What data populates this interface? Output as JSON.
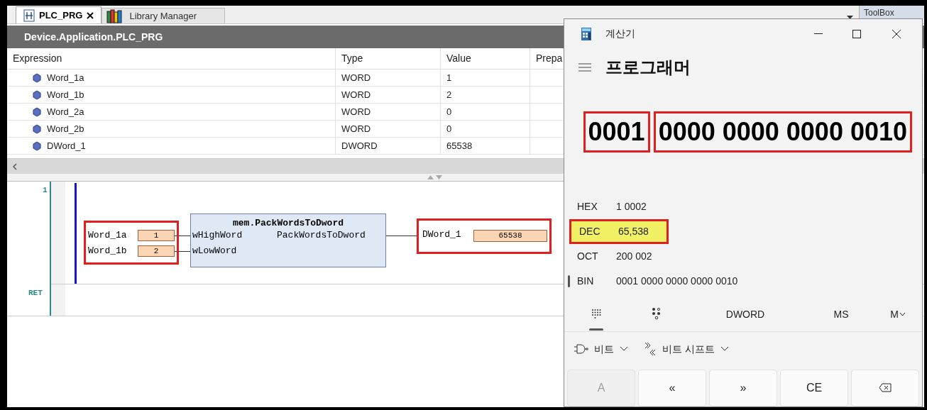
{
  "ide": {
    "tabs": [
      {
        "label": "PLC_PRG",
        "selected": true,
        "closable": true
      },
      {
        "label": "Library Manager",
        "selected": false,
        "closable": false
      }
    ],
    "toolbox": "ToolBox",
    "path": "Device.Application.PLC_PRG",
    "watch": {
      "columns": [
        "Expression",
        "Type",
        "Value",
        "Prepa"
      ],
      "rows": [
        {
          "expression": "Word_1a",
          "type": "WORD",
          "value": "1"
        },
        {
          "expression": "Word_1b",
          "type": "WORD",
          "value": "2"
        },
        {
          "expression": "Word_2a",
          "type": "WORD",
          "value": "0"
        },
        {
          "expression": "Word_2b",
          "type": "WORD",
          "value": "0"
        },
        {
          "expression": "DWord_1",
          "type": "DWORD",
          "value": "65538"
        }
      ]
    },
    "ladder": {
      "network_number": "1",
      "return_label": "RET",
      "block": {
        "title": "mem.PackWordsToDword",
        "inputs": [
          {
            "pin": "wHighWord",
            "variable": "Word_1a",
            "value": "1"
          },
          {
            "pin": "wLowWord",
            "variable": "Word_1b",
            "value": "2"
          }
        ],
        "output": {
          "pin": "PackWordsToDword",
          "variable": "DWord_1",
          "value": "65538"
        },
        "inputs_highlighted": true,
        "output_highlighted": true
      }
    }
  },
  "calculator": {
    "title": "계산기",
    "mode": "프로그래머",
    "display": [
      {
        "text": "0001",
        "highlighted": true
      },
      {
        "text": "0000 0000 0000 0010",
        "highlighted": true
      }
    ],
    "radix": [
      {
        "label": "HEX",
        "value": "1 0002",
        "selected": false,
        "highlighted": false
      },
      {
        "label": "DEC",
        "value": "65,538",
        "selected": false,
        "highlighted": true
      },
      {
        "label": "OCT",
        "value": "200 002",
        "selected": false,
        "highlighted": false
      },
      {
        "label": "BIN",
        "value": "0001 0000 0000 0000 0010",
        "selected": true,
        "highlighted": false
      }
    ],
    "toolbar": [
      {
        "kind": "keypad",
        "selected": true
      },
      {
        "kind": "bitpad",
        "selected": false
      },
      {
        "kind": "text",
        "label": "DWORD"
      },
      {
        "kind": "text",
        "label": "MS"
      },
      {
        "kind": "menu",
        "label": "M"
      }
    ],
    "bit_menus": [
      {
        "kind": "bitwise",
        "label": "비트"
      },
      {
        "kind": "shift",
        "label": "비트 시프트"
      }
    ],
    "keys": [
      {
        "kind": "text",
        "label": "A",
        "disabled": true
      },
      {
        "kind": "text",
        "label": "«",
        "disabled": false
      },
      {
        "kind": "text",
        "label": "»",
        "disabled": false
      },
      {
        "kind": "text",
        "label": "CE",
        "disabled": false
      },
      {
        "kind": "backspace",
        "disabled": false
      }
    ]
  }
}
